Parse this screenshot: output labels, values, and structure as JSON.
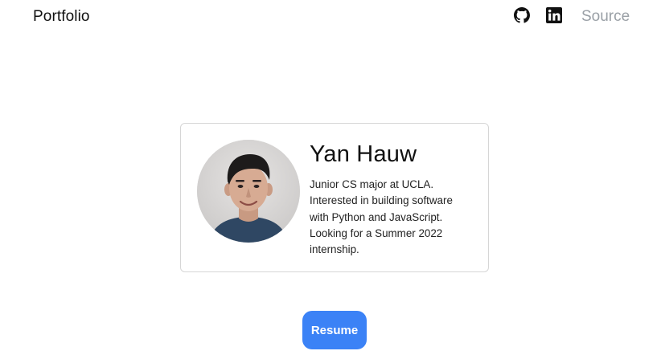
{
  "navbar": {
    "brand": "Portfolio",
    "icons": [
      "github-icon",
      "linkedin-icon"
    ],
    "source_label": "Source"
  },
  "profile": {
    "name": "Yan Hauw",
    "bio": "Junior CS major at UCLA. Interested in building software with Python and JavaScript. Looking for a Summer 2022 internship."
  },
  "resume_button": {
    "label": "Resume"
  },
  "colors": {
    "accent": "#3b82f6",
    "muted_link": "#9aa0a6",
    "card_border": "#d6d6d6"
  }
}
